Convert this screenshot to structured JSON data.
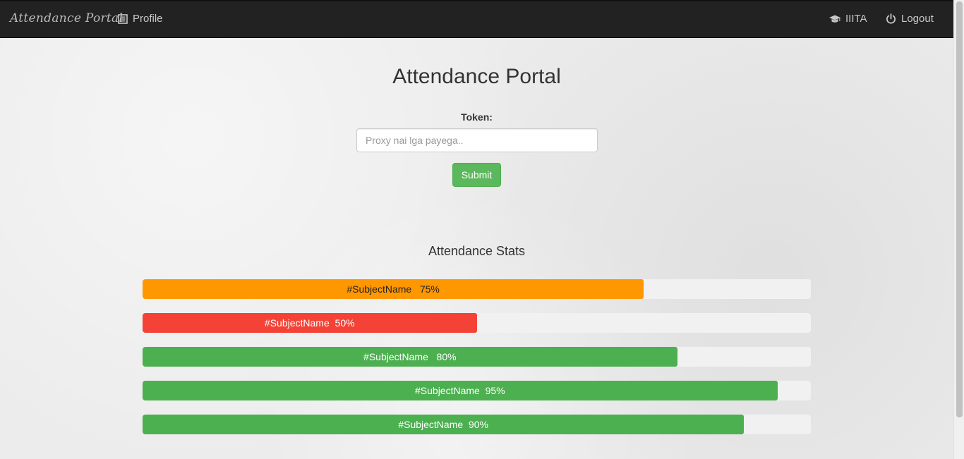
{
  "navbar": {
    "brand": "Attendance Portal",
    "profile_label": "Profile",
    "institute_label": "IIITA",
    "logout_label": "Logout"
  },
  "main": {
    "title": "Attendance Portal",
    "token_label": "Token:",
    "token_placeholder": "Proxy nai lga payega..",
    "token_value": "",
    "submit_label": "Submit"
  },
  "stats": {
    "title": "Attendance Stats",
    "subjects": [
      {
        "label": "#SubjectName   75%",
        "percent": 75,
        "color": "#ff9800",
        "text_color": "#222222"
      },
      {
        "label": "#SubjectName  50%",
        "percent": 50,
        "color": "#f44336",
        "text_color": "#ffffff"
      },
      {
        "label": "#SubjectName   80%",
        "percent": 80,
        "color": "#4caf50",
        "text_color": "#ffffff"
      },
      {
        "label": "#SubjectName  95%",
        "percent": 95,
        "color": "#4caf50",
        "text_color": "#ffffff"
      },
      {
        "label": "#SubjectName  90%",
        "percent": 90,
        "color": "#4caf50",
        "text_color": "#ffffff"
      }
    ]
  }
}
